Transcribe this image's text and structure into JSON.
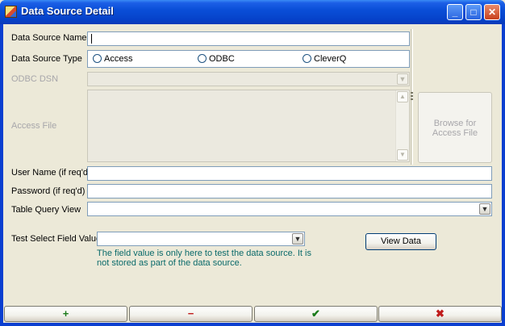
{
  "window": {
    "title": "Data Source Detail"
  },
  "titlebar_buttons": {
    "minimize": "_",
    "maximize": "□",
    "close": "✕"
  },
  "form": {
    "data_source_name": {
      "label": "Data Source Name",
      "value": ""
    },
    "data_source_type": {
      "label": "Data Source Type",
      "options": [
        "Access",
        "ODBC",
        "CleverQ"
      ]
    },
    "odbc_dsn": {
      "label": "ODBC DSN"
    },
    "access_file": {
      "label": "Access File",
      "browse_label": "Browse for Access File"
    },
    "user_name": {
      "label": "User Name (if req'd)"
    },
    "password": {
      "label": "Password (if req'd)"
    },
    "table_query_view": {
      "label": "Table Query View"
    },
    "test_select": {
      "label": "Test Select Field Value",
      "view_button": "View Data",
      "hint": "The field value is only here to test the data source.   It is not stored as part of the data source."
    }
  },
  "bottom_buttons": {
    "add": "+",
    "remove": "−",
    "ok": "✔",
    "cancel": "✖"
  },
  "colors": {
    "add": "#1a7a1a",
    "remove": "#c01c1c",
    "ok": "#1a7a1a",
    "cancel": "#c01c1c",
    "hint": "#0a6a6a"
  },
  "icons": {
    "combo": "chevron-down-icon",
    "scroll_up": "arrow-up-icon",
    "scroll_down": "arrow-down-icon"
  }
}
